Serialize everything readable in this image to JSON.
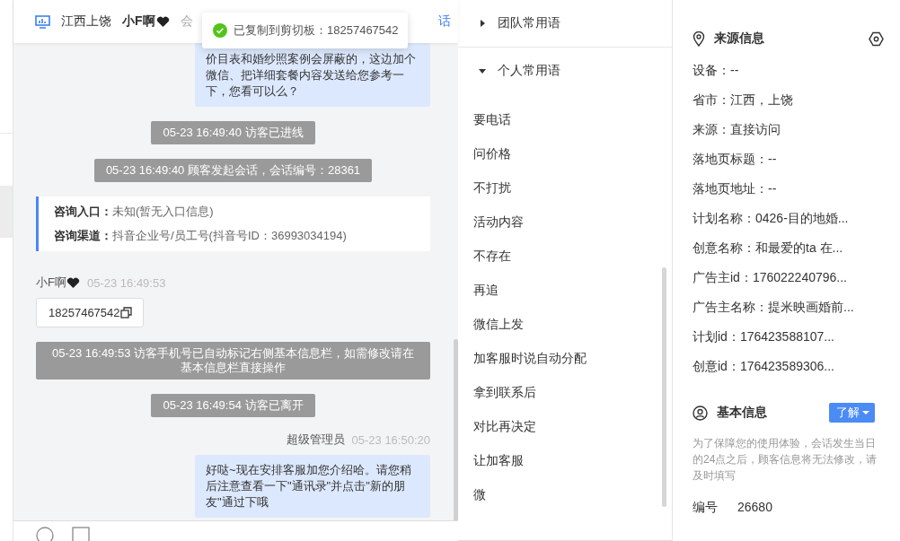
{
  "header": {
    "location": "江西上饶",
    "visitor": "小F啊",
    "visitor_heart": true,
    "status": "会",
    "link": "话"
  },
  "toast": {
    "text": "已复制到剪切板：18257467542"
  },
  "messages": [
    {
      "kind": "agent_bubble",
      "text": "价目表和婚纱照案例会屏蔽的，这边加个微信、把详细套餐内容发送给您参考一下，您看可以么？"
    },
    {
      "kind": "system",
      "text": "05-23 16:49:40 访客已进线"
    },
    {
      "kind": "system",
      "text": "05-23 16:49:40 顾客发起会话，会话编号：28361"
    },
    {
      "kind": "info_card",
      "rows": [
        {
          "label": "咨询入口：",
          "value": "未知(暂无入口信息)"
        },
        {
          "label": "咨询渠道：",
          "value": "抖音企业号/员工号(抖音号ID：36993034194)"
        }
      ]
    },
    {
      "kind": "visitor_sender",
      "name": "小F啊",
      "heart": true,
      "time": "05-23 16:49:53"
    },
    {
      "kind": "phone",
      "text": "18257467542"
    },
    {
      "kind": "system",
      "text": "05-23 16:49:53 访客手机号已自动标记右侧基本信息栏，如需修改请在基本信息栏直接操作"
    },
    {
      "kind": "system",
      "text": "05-23 16:49:54 访客已离开"
    },
    {
      "kind": "agent_sender",
      "name": "超级管理员",
      "heart": false,
      "time": "05-23 16:50:20"
    },
    {
      "kind": "agent_bubble",
      "text": "好哒~现在安排客服加您介绍哈。请您稍后注意查看一下\"通讯录\"并点击\"新的朋友\"通过下哦"
    }
  ],
  "phrases": {
    "groups": [
      {
        "title": "团队常用语",
        "expanded": false
      },
      {
        "title": "个人常用语",
        "expanded": true
      }
    ],
    "items": [
      "要电话",
      "问价格",
      "不打扰",
      "活动内容",
      "不存在",
      "再追",
      "微信上发",
      "加客服时说自动分配",
      "拿到联系后",
      "对比再决定",
      "让加客服",
      "微"
    ]
  },
  "source_info": {
    "title": "来源信息",
    "rows": [
      "设备：--",
      "省市：江西，上饶",
      "来源：直接访问",
      "落地页标题：--",
      "落地页地址：--",
      "计划名称：0426-目的地婚...",
      "创意名称：和最爱的ta 在...",
      "广告主id：176022240796...",
      "广告主名称：提米映画婚前...",
      "计划id：176423588107...",
      "创意id：176423589306..."
    ]
  },
  "basic_info": {
    "title": "基本信息",
    "button": "了解",
    "note": "为了保障您的使用体验，会话发生当日的24点之后，顾客信息将无法修改，请及时填写",
    "id_label": "编号",
    "id_value": "26680"
  }
}
